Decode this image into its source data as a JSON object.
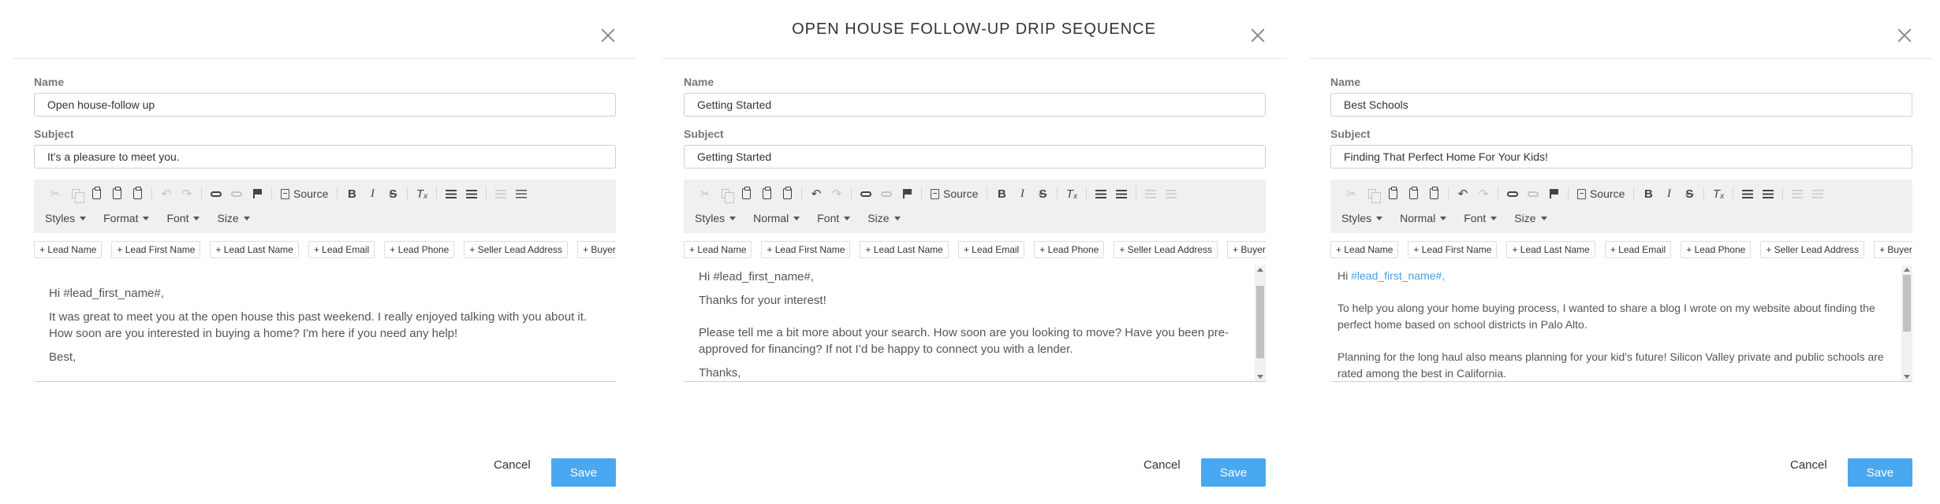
{
  "panels": [
    {
      "title": "",
      "name_label": "Name",
      "name_value": "Open house-follow up",
      "subject_label": "Subject",
      "subject_value": "It's a pleasure to meet you.",
      "toolbar": {
        "source_label": "Source",
        "dropdowns": [
          "Styles",
          "Format",
          "Font",
          "Size"
        ]
      },
      "tags": [
        "+ Lead Name",
        "+ Lead First Name",
        "+ Lead Last Name",
        "+ Lead Email",
        "+ Lead Phone",
        "+ Seller Lead Address"
      ],
      "tag_dropdown": "+ Buyer Lead City",
      "body": {
        "greeting": "Hi #lead_first_name#,",
        "para1": "It was great to meet you at the open house this past weekend. I really enjoyed talking with you about it. How soon are you interested in buying a home? I'm here if you need any help!",
        "closing": "Best,"
      },
      "cancel_label": "Cancel",
      "save_label": "Save"
    },
    {
      "title": "OPEN HOUSE FOLLOW-UP DRIP SEQUENCE",
      "name_label": "Name",
      "name_value": "Getting Started",
      "subject_label": "Subject",
      "subject_value": "Getting Started",
      "toolbar": {
        "source_label": "Source",
        "dropdowns": [
          "Styles",
          "Normal",
          "Font",
          "Size"
        ]
      },
      "tags": [
        "+ Lead Name",
        "+ Lead First Name",
        "+ Lead Last Name",
        "+ Lead Email",
        "+ Lead Phone",
        "+ Seller Lead Address"
      ],
      "tag_dropdown": "+ Buyer Lead City",
      "body": {
        "greeting": "Hi #lead_first_name#,",
        "para1": "Thanks for your interest!",
        "para2": "Please tell me a bit more about your search. How soon are you looking to move? Have you been pre-approved for financing? If not I’d be happy to connect you with a lender.",
        "closing": "Thanks,"
      },
      "cancel_label": "Cancel",
      "save_label": "Save"
    },
    {
      "title": "",
      "name_label": "Name",
      "name_value": "Best Schools",
      "subject_label": "Subject",
      "subject_value": "Finding That Perfect Home For Your Kids!",
      "toolbar": {
        "source_label": "Source",
        "dropdowns": [
          "Styles",
          "Normal",
          "Font",
          "Size"
        ]
      },
      "tags": [
        "+ Lead Name",
        "+ Lead First Name",
        "+ Lead Last Name",
        "+ Lead Email",
        "+ Lead Phone",
        "+ Seller Lead Address"
      ],
      "tag_dropdown": "+ Buyer Lead City",
      "body": {
        "greeting_prefix": "Hi ",
        "greeting_token": "#lead_first_name#,",
        "para1": "To help you along your home buying process, I wanted to share a blog I wrote on my website about finding the perfect home based on school districts in Palo Alto.",
        "para2": "Planning for the long haul also means planning for your kid's future! Silicon Valley private and public schools are rated among the best in California."
      },
      "cancel_label": "Cancel",
      "save_label": "Save"
    }
  ],
  "colors": {
    "save_button": "#4aa8f0",
    "toolbar_bg": "#f0f0f0",
    "token_link": "#4a9fe0"
  }
}
